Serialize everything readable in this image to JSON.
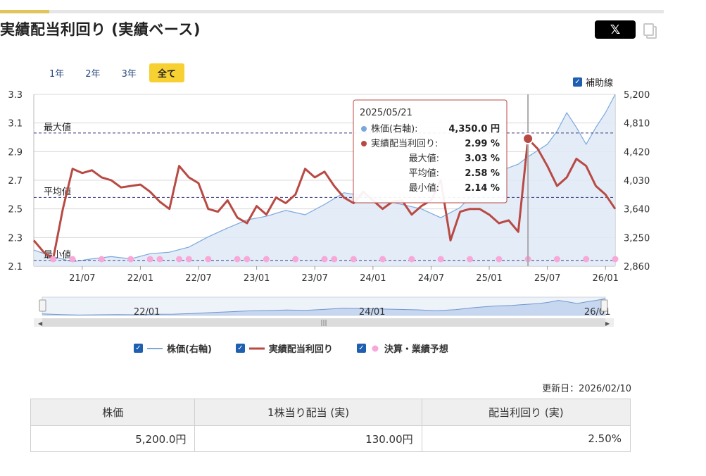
{
  "page": {
    "title": "実績配当利回り (実績ベース)",
    "share_label": "𝕏",
    "ranges": [
      "1年",
      "2年",
      "3年",
      "全て"
    ],
    "active_range": "全て",
    "helper_label": "補助線",
    "updated": "更新日：2026/02/10"
  },
  "legend": {
    "price": "株価(右軸)",
    "yield": "実績配当利回り",
    "events": "決算・業績予想"
  },
  "tooltip": {
    "date": "2025/05/21",
    "rows": [
      {
        "label": "株価(右軸):",
        "value": "4,350.0 円",
        "marker": "price"
      },
      {
        "label": "実績配当利回り:",
        "value": "2.99 %",
        "marker": "yield"
      },
      {
        "label": "最大値:",
        "value": "3.03 %",
        "marker": ""
      },
      {
        "label": "平均値:",
        "value": "2.58 %",
        "marker": ""
      },
      {
        "label": "最小値:",
        "value": "2.14 %",
        "marker": ""
      }
    ]
  },
  "table": {
    "headers": [
      "株価",
      "1株当り配当 (実)",
      "配当利回り (実)"
    ],
    "values": [
      "5,200.0円",
      "130.00円",
      "2.50%"
    ]
  },
  "colors": {
    "price": "#7aa8dc",
    "price_fill": "#dfe9f7",
    "yield": "#b84a44",
    "events": "#f7a8d8",
    "accent": "#f7d031"
  },
  "chart_data": {
    "type": "line",
    "x_range": [
      "2021/02",
      "2026/02"
    ],
    "x_ticks": [
      "21/07",
      "22/01",
      "22/07",
      "23/01",
      "23/07",
      "24/01",
      "24/07",
      "25/01",
      "25/07",
      "26/01"
    ],
    "navigator_ticks": [
      "22/01",
      "24/01",
      "26/01"
    ],
    "y_left": {
      "min": 2.1,
      "max": 3.3,
      "ticks": [
        "2.1",
        "2.3",
        "2.5",
        "2.7",
        "2.9",
        "3.1",
        "3.3"
      ]
    },
    "y_right": {
      "min": 2860,
      "max": 5200,
      "ticks": [
        "2,860",
        "3,250",
        "3,640",
        "4,030",
        "4,420",
        "4,810",
        "5,200"
      ]
    },
    "reference_lines": [
      {
        "name": "最大値",
        "value": 3.03
      },
      {
        "name": "平均値",
        "value": 2.58
      },
      {
        "name": "最小値",
        "value": 2.14
      }
    ],
    "series": [
      {
        "name": "株価(右軸)",
        "axis": "right",
        "points": [
          [
            "2021/02",
            3080
          ],
          [
            "2021/04",
            2990
          ],
          [
            "2021/06",
            2920
          ],
          [
            "2021/08",
            2960
          ],
          [
            "2021/10",
            2990
          ],
          [
            "2021/12",
            2960
          ],
          [
            "2022/02",
            3030
          ],
          [
            "2022/04",
            3050
          ],
          [
            "2022/06",
            3120
          ],
          [
            "2022/08",
            3260
          ],
          [
            "2022/10",
            3380
          ],
          [
            "2022/12",
            3490
          ],
          [
            "2023/02",
            3540
          ],
          [
            "2023/04",
            3620
          ],
          [
            "2023/06",
            3560
          ],
          [
            "2023/08",
            3700
          ],
          [
            "2023/10",
            3860
          ],
          [
            "2023/12",
            3820
          ],
          [
            "2024/02",
            3760
          ],
          [
            "2024/04",
            3700
          ],
          [
            "2024/06",
            3640
          ],
          [
            "2024/08",
            3520
          ],
          [
            "2024/10",
            3660
          ],
          [
            "2024/12",
            3940
          ],
          [
            "2025/02",
            4150
          ],
          [
            "2025/04",
            4250
          ],
          [
            "2025/05",
            4350
          ],
          [
            "2025/07",
            4520
          ],
          [
            "2025/08",
            4700
          ],
          [
            "2025/09",
            4950
          ],
          [
            "2025/10",
            4750
          ],
          [
            "2025/11",
            4520
          ],
          [
            "2025/12",
            4750
          ],
          [
            "2026/01",
            4950
          ],
          [
            "2026/02",
            5200
          ]
        ]
      },
      {
        "name": "実績配当利回り",
        "axis": "left",
        "points": [
          [
            "2021/02",
            2.28
          ],
          [
            "2021/03",
            2.2
          ],
          [
            "2021/04",
            2.15
          ],
          [
            "2021/05",
            2.5
          ],
          [
            "2021/06",
            2.78
          ],
          [
            "2021/07",
            2.75
          ],
          [
            "2021/08",
            2.77
          ],
          [
            "2021/09",
            2.72
          ],
          [
            "2021/10",
            2.7
          ],
          [
            "2021/11",
            2.65
          ],
          [
            "2021/12",
            2.66
          ],
          [
            "2022/01",
            2.67
          ],
          [
            "2022/02",
            2.62
          ],
          [
            "2022/03",
            2.55
          ],
          [
            "2022/04",
            2.5
          ],
          [
            "2022/05",
            2.8
          ],
          [
            "2022/06",
            2.72
          ],
          [
            "2022/07",
            2.68
          ],
          [
            "2022/08",
            2.5
          ],
          [
            "2022/09",
            2.48
          ],
          [
            "2022/10",
            2.56
          ],
          [
            "2022/11",
            2.44
          ],
          [
            "2022/12",
            2.4
          ],
          [
            "2023/01",
            2.52
          ],
          [
            "2023/02",
            2.46
          ],
          [
            "2023/03",
            2.58
          ],
          [
            "2023/04",
            2.54
          ],
          [
            "2023/05",
            2.6
          ],
          [
            "2023/06",
            2.78
          ],
          [
            "2023/07",
            2.72
          ],
          [
            "2023/08",
            2.76
          ],
          [
            "2023/09",
            2.66
          ],
          [
            "2023/10",
            2.58
          ],
          [
            "2023/11",
            2.54
          ],
          [
            "2023/12",
            2.62
          ],
          [
            "2024/01",
            2.56
          ],
          [
            "2024/02",
            2.5
          ],
          [
            "2024/03",
            2.55
          ],
          [
            "2024/04",
            2.56
          ],
          [
            "2024/05",
            2.46
          ],
          [
            "2024/06",
            2.52
          ],
          [
            "2024/07",
            2.56
          ],
          [
            "2024/08",
            2.7
          ],
          [
            "2024/09",
            2.28
          ],
          [
            "2024/10",
            2.48
          ],
          [
            "2024/11",
            2.5
          ],
          [
            "2024/12",
            2.5
          ],
          [
            "2025/01",
            2.46
          ],
          [
            "2025/02",
            2.4
          ],
          [
            "2025/03",
            2.42
          ],
          [
            "2025/04",
            2.34
          ],
          [
            "2025/05",
            2.99
          ],
          [
            "2025/06",
            2.92
          ],
          [
            "2025/07",
            2.8
          ],
          [
            "2025/08",
            2.66
          ],
          [
            "2025/09",
            2.72
          ],
          [
            "2025/10",
            2.85
          ],
          [
            "2025/11",
            2.8
          ],
          [
            "2025/12",
            2.66
          ],
          [
            "2026/01",
            2.6
          ],
          [
            "2026/02",
            2.5
          ]
        ]
      }
    ],
    "events": [
      "2021/04",
      "2021/06",
      "2021/09",
      "2021/12",
      "2022/02",
      "2022/03",
      "2022/05",
      "2022/06",
      "2022/08",
      "2022/11",
      "2022/12",
      "2023/02",
      "2023/05",
      "2023/08",
      "2023/09",
      "2023/11",
      "2024/02",
      "2024/05",
      "2024/08",
      "2024/11",
      "2025/02",
      "2025/05",
      "2025/08",
      "2025/11",
      "2026/02"
    ]
  }
}
